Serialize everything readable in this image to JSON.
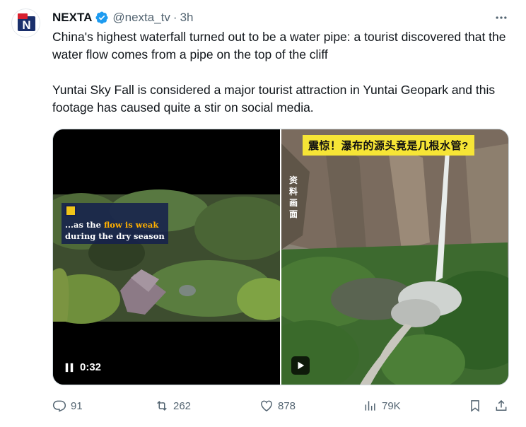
{
  "author": {
    "name": "NEXTA",
    "handle": "@nexta_tv",
    "separator": "·",
    "time": "3h",
    "avatar_letter": "N"
  },
  "tweet": {
    "paragraph1": "China's highest waterfall turned out to be a water pipe: a tourist discovered that the water flow comes from a pipe on the top of the cliff",
    "paragraph2": "Yuntai Sky Fall is considered a major tourist attraction in Yuntai Geopark and this footage has caused quite a stir on social media."
  },
  "media": {
    "left_video": {
      "duration": "0:32",
      "caption_line1_prefix": "...as the ",
      "caption_line1_highlight": "flow is weak",
      "caption_line2": "during the dry season"
    },
    "right_video": {
      "banner": "震惊！瀑布的源头竟是几根水管?",
      "side_label": "资料画面"
    }
  },
  "actions": {
    "replies": "91",
    "reposts": "262",
    "likes": "878",
    "views": "79K"
  },
  "colors": {
    "text_primary": "#0f1419",
    "text_secondary": "#536471",
    "verified_blue": "#1d9bf0",
    "brand_red": "#d9202f",
    "brand_navy": "#1a2f6b",
    "caption_highlight": "#ffb000",
    "banner_yellow": "#f6e536"
  }
}
